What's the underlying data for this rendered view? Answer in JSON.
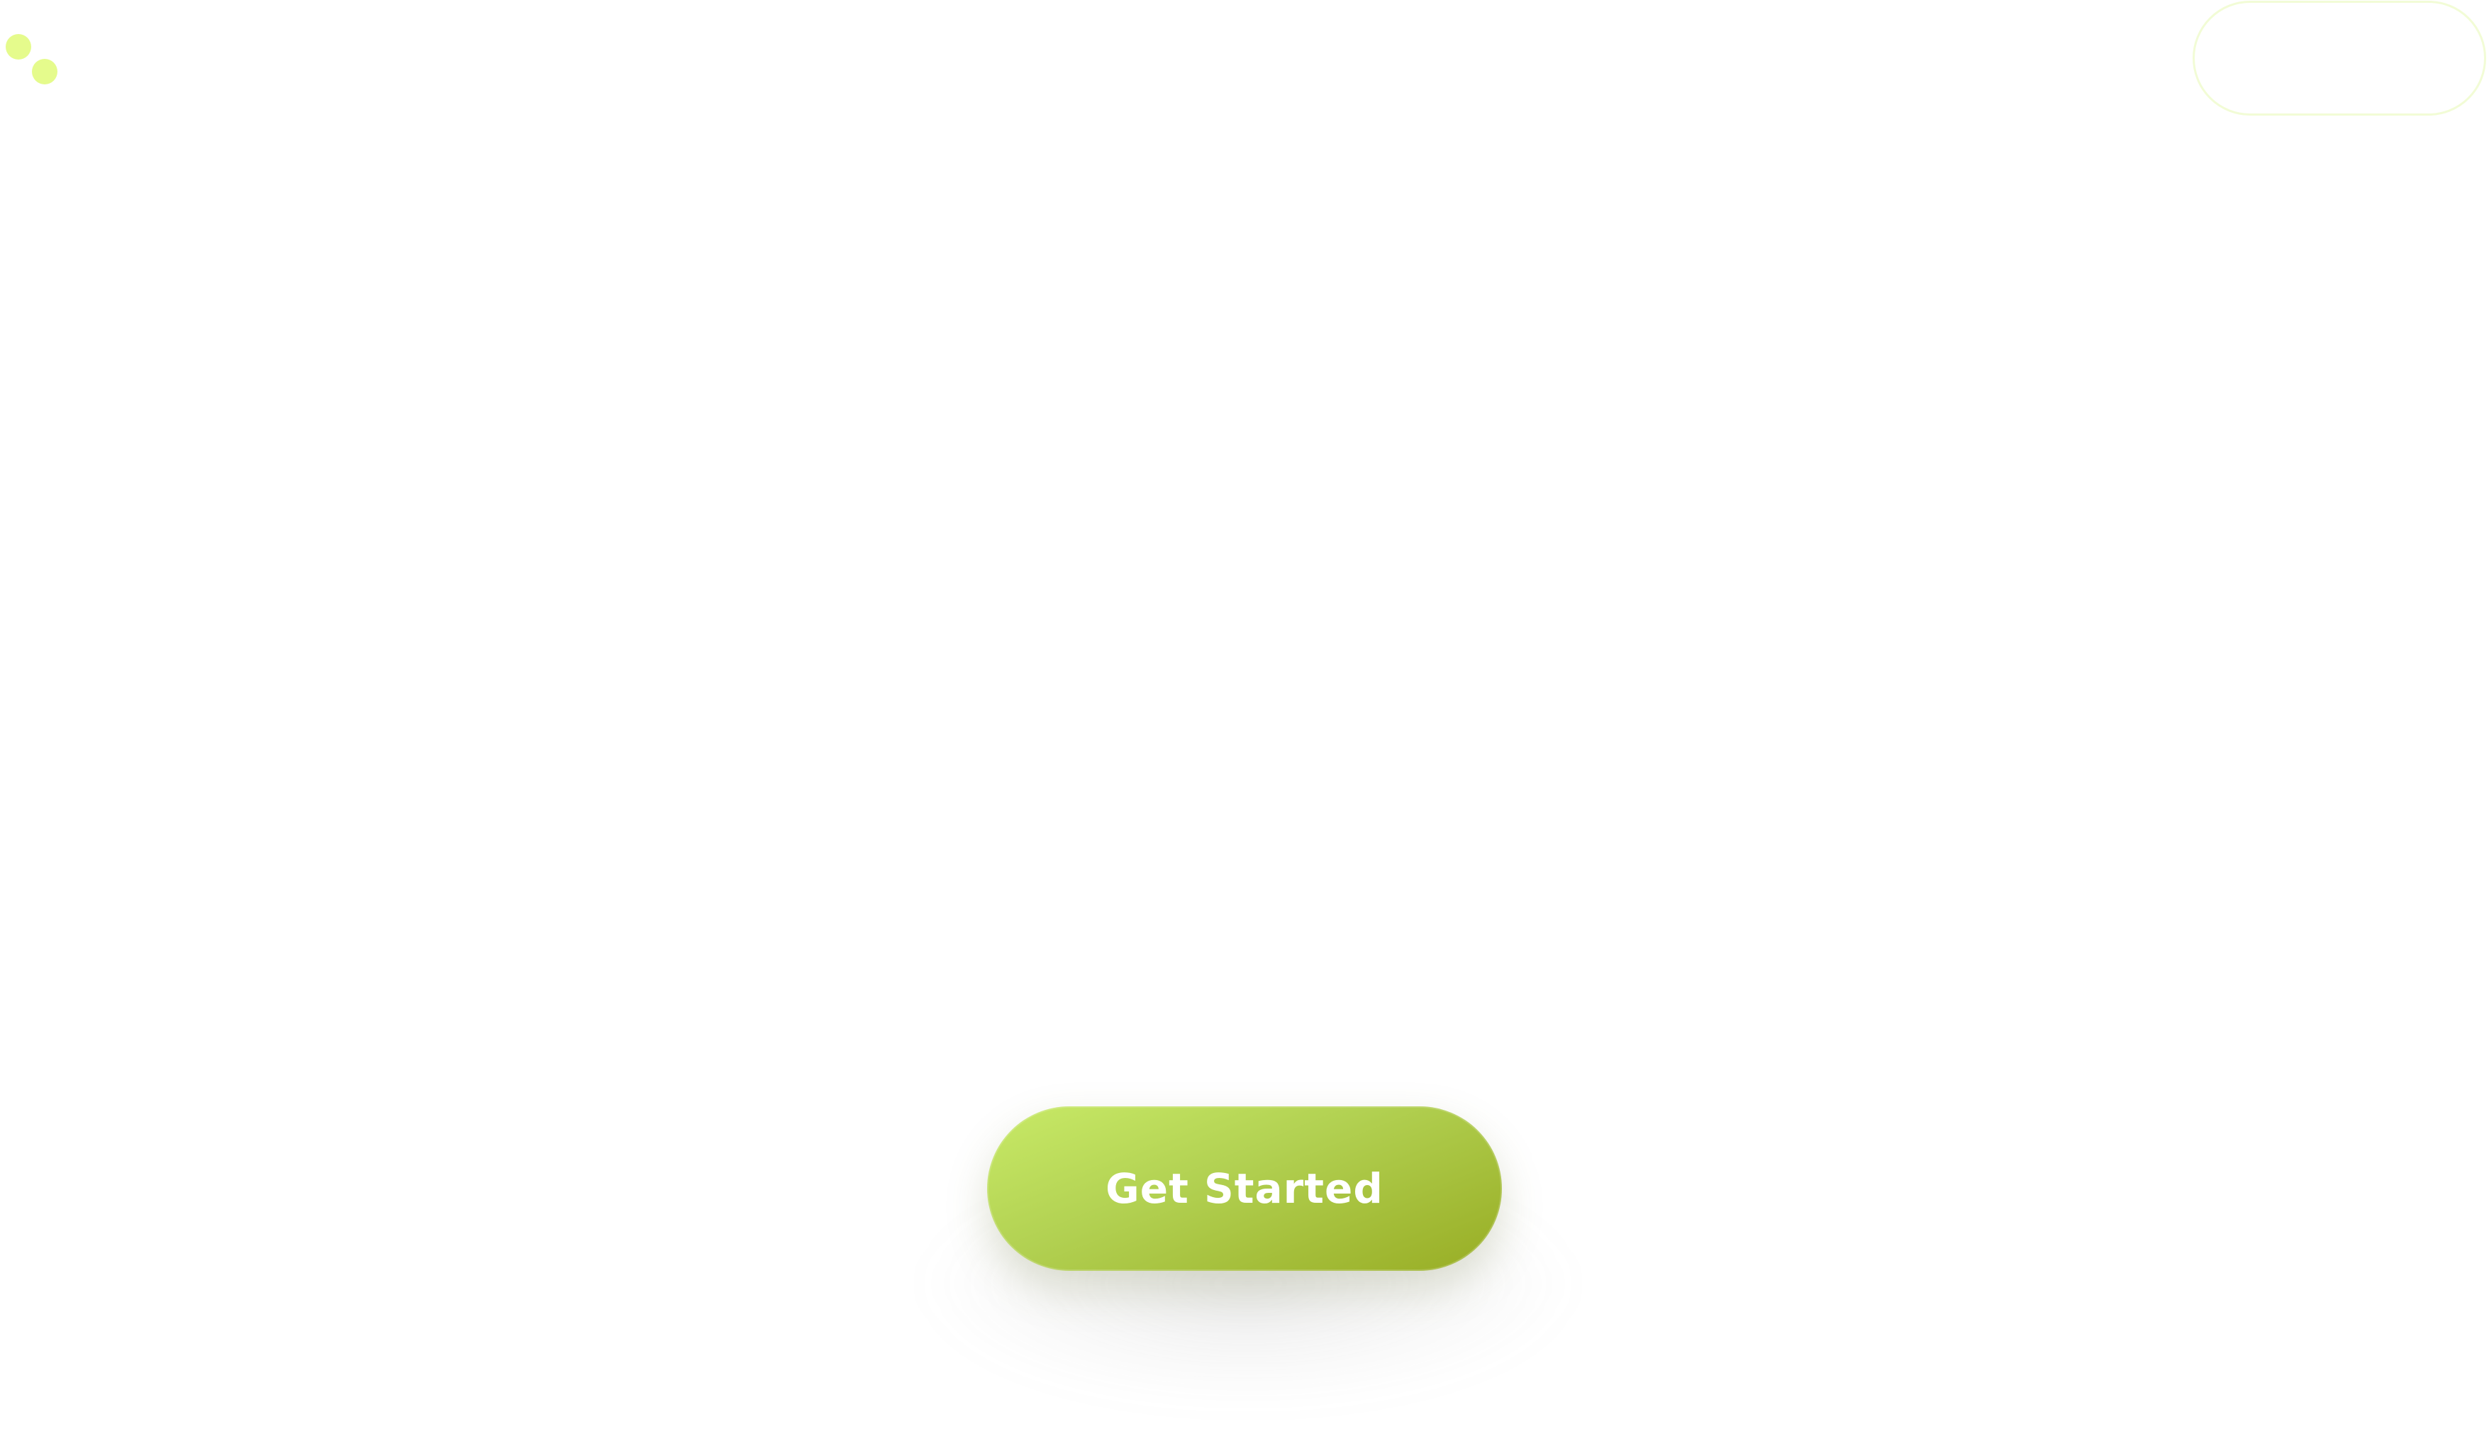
{
  "brand": {
    "logo_icon": "two-dot-logo-icon",
    "dot_color": "#e5fb8c"
  },
  "header": {
    "pill_button_label": "",
    "pill_border_color": "#f2fcd6"
  },
  "hero": {
    "cta_label": "Get Started",
    "cta_gradient": [
      "#c8ea67",
      "#b2d152",
      "#98ad24"
    ],
    "cta_text_color": "#ffffff"
  }
}
